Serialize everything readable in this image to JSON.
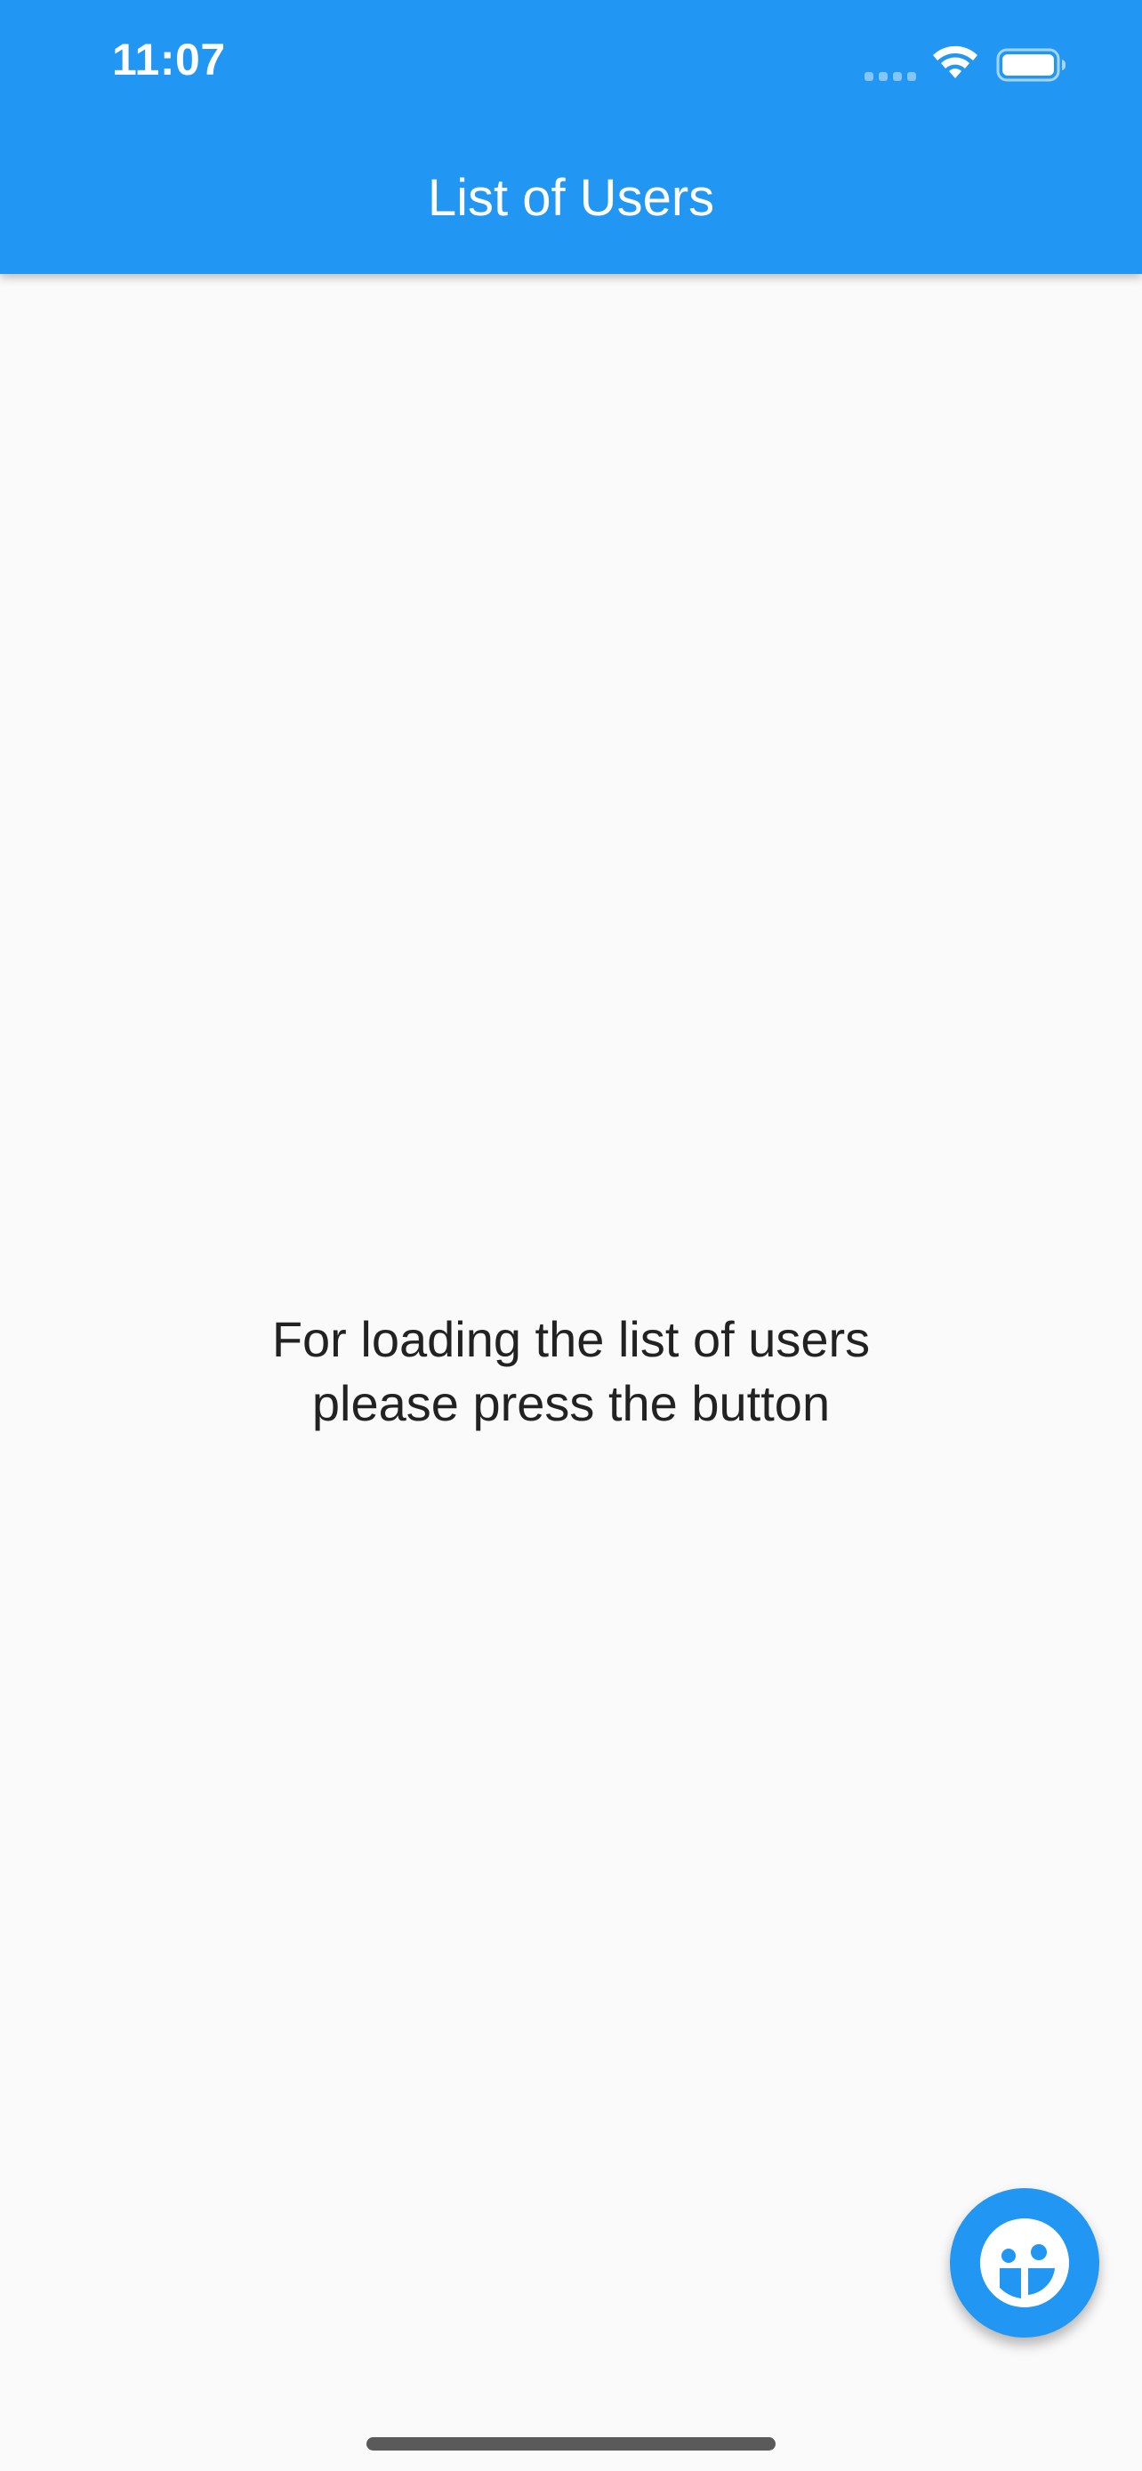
{
  "status_bar": {
    "time": "11:07",
    "signal_icon": "cellular-signal-icon",
    "wifi_icon": "wifi-icon",
    "battery_icon": "battery-icon"
  },
  "app_bar": {
    "title": "List of Users",
    "background_color": "#2196f3"
  },
  "body": {
    "message": "For loading the list of users\nplease press the button"
  },
  "fab": {
    "icon": "face-icon",
    "color": "#2196f3"
  }
}
